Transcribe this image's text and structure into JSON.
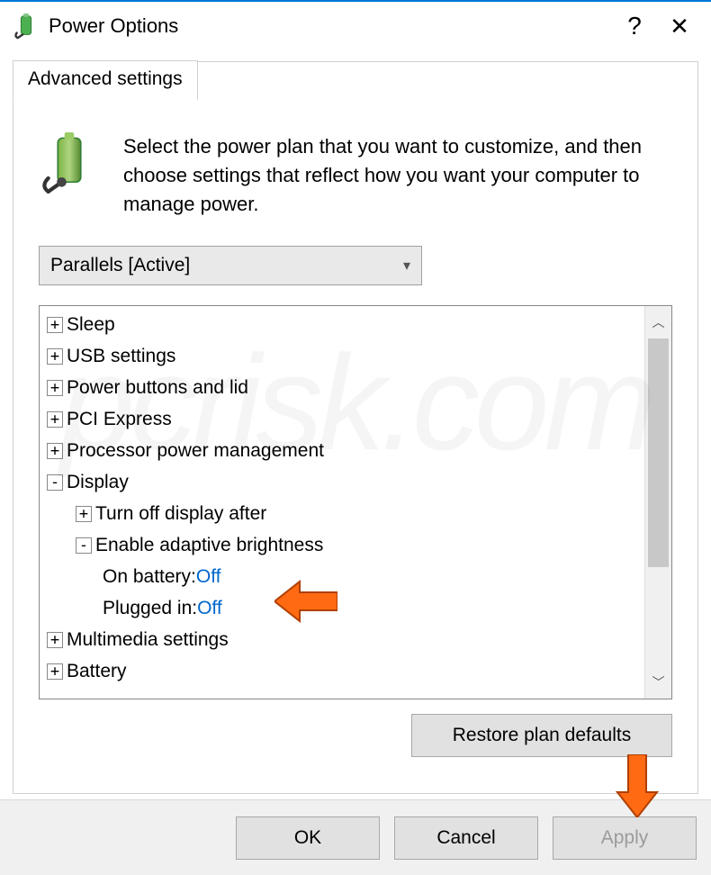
{
  "title": "Power Options",
  "tab_label": "Advanced settings",
  "description": "Select the power plan that you want to customize, and then choose settings that reflect how you want your computer to manage power.",
  "plan_selected": "Parallels [Active]",
  "tree": {
    "sleep": "Sleep",
    "usb": "USB settings",
    "power_buttons": "Power buttons and lid",
    "pci": "PCI Express",
    "processor": "Processor power management",
    "display": "Display",
    "turn_off": "Turn off display after",
    "adaptive": "Enable adaptive brightness",
    "on_battery_label": "On battery: ",
    "on_battery_value": "Off",
    "plugged_label": "Plugged in: ",
    "plugged_value": "Off",
    "multimedia": "Multimedia settings",
    "battery": "Battery"
  },
  "restore_label": "Restore plan defaults",
  "buttons": {
    "ok": "OK",
    "cancel": "Cancel",
    "apply": "Apply"
  },
  "watermark": "pcrisk.com"
}
